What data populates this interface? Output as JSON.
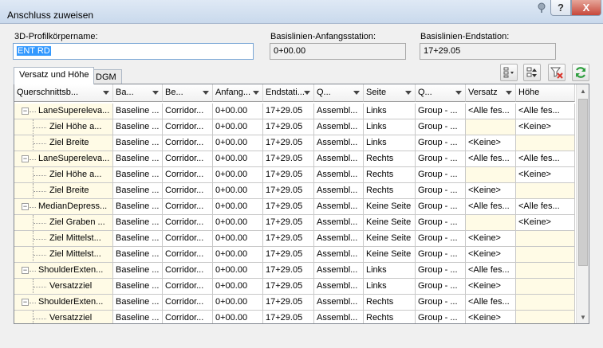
{
  "window": {
    "title": "Anschluss zuweisen",
    "help_label": "?",
    "close_label": "X"
  },
  "fields": {
    "profile_label": "3D-Profilkörpername:",
    "profile_value": "ENT RD",
    "start_label": "Basislinien-Anfangsstation:",
    "start_value": "0+00.00",
    "end_label": "Basislinien-Endstation:",
    "end_value": "17+29.05"
  },
  "tabs": [
    {
      "label": "Versatz und Höhe"
    },
    {
      "label": "DGM"
    }
  ],
  "columns": [
    "Querschnittsb...",
    "Ba...",
    "Be...",
    "Anfang...",
    "Endstati...",
    "Q...",
    "Seite",
    "Q...",
    "Versatz",
    "Höhe"
  ],
  "rows": [
    {
      "name": "LaneSupereleva...",
      "level": 0,
      "baseline": "Baseline ...",
      "region": "Corridor...",
      "start": "0+00.00",
      "end": "17+29.05",
      "assembly": "Assembl...",
      "side": "Links",
      "group": "Group - ...",
      "offset": "<Alle fes...",
      "elevation": "<Alle fes..."
    },
    {
      "name": "Ziel Höhe a...",
      "level": 1,
      "baseline": "Baseline ...",
      "region": "Corridor...",
      "start": "0+00.00",
      "end": "17+29.05",
      "assembly": "Assembl...",
      "side": "Links",
      "group": "Group - ...",
      "offset": "",
      "elevation": "<Keine>"
    },
    {
      "name": "Ziel Breite",
      "level": 1,
      "baseline": "Baseline ...",
      "region": "Corridor...",
      "start": "0+00.00",
      "end": "17+29.05",
      "assembly": "Assembl...",
      "side": "Links",
      "group": "Group - ...",
      "offset": "<Keine>",
      "elevation": ""
    },
    {
      "name": "LaneSupereleva...",
      "level": 0,
      "baseline": "Baseline ...",
      "region": "Corridor...",
      "start": "0+00.00",
      "end": "17+29.05",
      "assembly": "Assembl...",
      "side": "Rechts",
      "group": "Group - ...",
      "offset": "<Alle fes...",
      "elevation": "<Alle fes..."
    },
    {
      "name": "Ziel Höhe a...",
      "level": 1,
      "baseline": "Baseline ...",
      "region": "Corridor...",
      "start": "0+00.00",
      "end": "17+29.05",
      "assembly": "Assembl...",
      "side": "Rechts",
      "group": "Group - ...",
      "offset": "",
      "elevation": "<Keine>"
    },
    {
      "name": "Ziel Breite",
      "level": 1,
      "baseline": "Baseline ...",
      "region": "Corridor...",
      "start": "0+00.00",
      "end": "17+29.05",
      "assembly": "Assembl...",
      "side": "Rechts",
      "group": "Group - ...",
      "offset": "<Keine>",
      "elevation": ""
    },
    {
      "name": "MedianDepress...",
      "level": 0,
      "baseline": "Baseline ...",
      "region": "Corridor...",
      "start": "0+00.00",
      "end": "17+29.05",
      "assembly": "Assembl...",
      "side": "Keine Seite",
      "group": "Group - ...",
      "offset": "<Alle fes...",
      "elevation": "<Alle fes..."
    },
    {
      "name": "Ziel Graben ...",
      "level": 1,
      "baseline": "Baseline ...",
      "region": "Corridor...",
      "start": "0+00.00",
      "end": "17+29.05",
      "assembly": "Assembl...",
      "side": "Keine Seite",
      "group": "Group - ...",
      "offset": "",
      "elevation": "<Keine>"
    },
    {
      "name": "Ziel Mittelst...",
      "level": 1,
      "baseline": "Baseline ...",
      "region": "Corridor...",
      "start": "0+00.00",
      "end": "17+29.05",
      "assembly": "Assembl...",
      "side": "Keine Seite",
      "group": "Group - ...",
      "offset": "<Keine>",
      "elevation": ""
    },
    {
      "name": "Ziel Mittelst...",
      "level": 1,
      "baseline": "Baseline ...",
      "region": "Corridor...",
      "start": "0+00.00",
      "end": "17+29.05",
      "assembly": "Assembl...",
      "side": "Keine Seite",
      "group": "Group - ...",
      "offset": "<Keine>",
      "elevation": ""
    },
    {
      "name": "ShoulderExten...",
      "level": 0,
      "baseline": "Baseline ...",
      "region": "Corridor...",
      "start": "0+00.00",
      "end": "17+29.05",
      "assembly": "Assembl...",
      "side": "Links",
      "group": "Group - ...",
      "offset": "<Alle fes...",
      "elevation": ""
    },
    {
      "name": "Versatzziel",
      "level": 1,
      "baseline": "Baseline ...",
      "region": "Corridor...",
      "start": "0+00.00",
      "end": "17+29.05",
      "assembly": "Assembl...",
      "side": "Links",
      "group": "Group - ...",
      "offset": "<Keine>",
      "elevation": ""
    },
    {
      "name": "ShoulderExten...",
      "level": 0,
      "baseline": "Baseline ...",
      "region": "Corridor...",
      "start": "0+00.00",
      "end": "17+29.05",
      "assembly": "Assembl...",
      "side": "Rechts",
      "group": "Group - ...",
      "offset": "<Alle fes...",
      "elevation": ""
    },
    {
      "name": "Versatzziel",
      "level": 1,
      "baseline": "Baseline ...",
      "region": "Corridor...",
      "start": "0+00.00",
      "end": "17+29.05",
      "assembly": "Assembl...",
      "side": "Rechts",
      "group": "Group - ...",
      "offset": "<Keine>",
      "elevation": ""
    }
  ],
  "icons": {
    "pin": "pin-icon",
    "toolbar": [
      "column-chooser-icon",
      "sort-icon",
      "clear-filter-icon",
      "refresh-icon"
    ]
  },
  "colors": {
    "selection": "#3399ff",
    "cell_highlight": "#fffbe6",
    "refresh": "#2e9e3e",
    "clear_filter": "#d9342b"
  }
}
